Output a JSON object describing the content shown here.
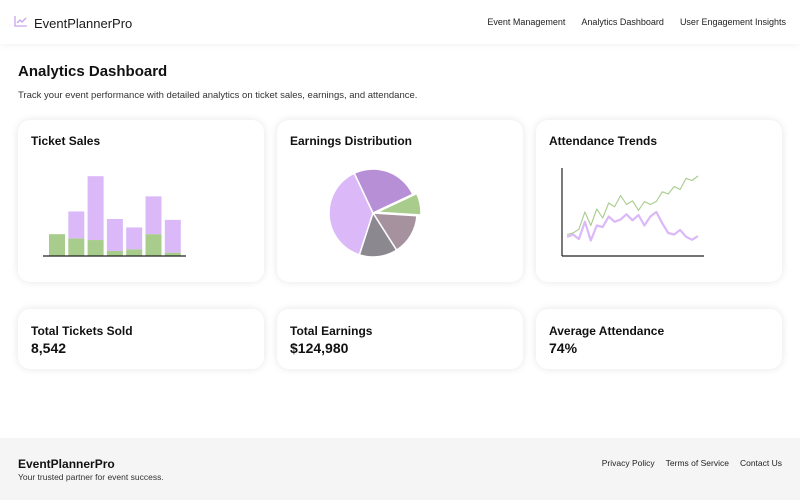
{
  "header": {
    "brand": "EventPlannerPro",
    "logo_icon": "trending-up-icon",
    "nav": [
      "Event Management",
      "Analytics Dashboard",
      "User Engagement Insights"
    ]
  },
  "main": {
    "title": "Analytics Dashboard",
    "subtitle": "Track your event performance with detailed analytics on ticket sales, earnings, and attendance."
  },
  "colors": {
    "green": "#a8cc8c",
    "lavender": "#dbb8f8",
    "purple": "#b78fd6",
    "mauve": "#a6929f",
    "gray": "#8c8890"
  },
  "cards": {
    "ticket_sales": {
      "title": "Ticket Sales"
    },
    "earnings": {
      "title": "Earnings Distribution"
    },
    "attendance": {
      "title": "Attendance Trends"
    }
  },
  "stats": [
    {
      "label": "Total Tickets Sold",
      "value": "8,542"
    },
    {
      "label": "Total Earnings",
      "value": "$124,980"
    },
    {
      "label": "Average Attendance",
      "value": "74%"
    }
  ],
  "chart_data": [
    {
      "type": "bar",
      "title": "Ticket Sales",
      "categories": [
        "",
        "",
        "",
        "",
        "",
        "",
        ""
      ],
      "ylim": [
        0,
        100
      ],
      "series": [
        {
          "values": [
            26,
            21,
            19,
            6,
            8,
            26,
            4
          ]
        },
        {
          "values": [
            0,
            32,
            76,
            38,
            26,
            45,
            39
          ]
        }
      ]
    },
    {
      "type": "pie",
      "title": "Earnings Distribution",
      "values": [
        38,
        25,
        8,
        15,
        14
      ]
    },
    {
      "type": "line",
      "title": "Attendance Trends",
      "ylim": [
        0,
        100
      ],
      "series": [
        {
          "values": [
            18,
            20,
            25,
            48,
            30,
            52,
            40,
            60,
            55,
            70,
            58,
            63,
            50,
            62,
            58,
            62,
            75,
            72,
            82,
            78,
            93,
            90,
            96
          ]
        },
        {
          "values": [
            15,
            18,
            12,
            35,
            10,
            30,
            28,
            42,
            35,
            38,
            45,
            37,
            44,
            30,
            42,
            48,
            33,
            20,
            18,
            24,
            15,
            11,
            16
          ]
        }
      ]
    }
  ],
  "footer": {
    "brand": "EventPlannerPro",
    "tagline": "Your trusted partner for event success.",
    "links": [
      "Privacy Policy",
      "Terms of Service",
      "Contact Us"
    ]
  }
}
